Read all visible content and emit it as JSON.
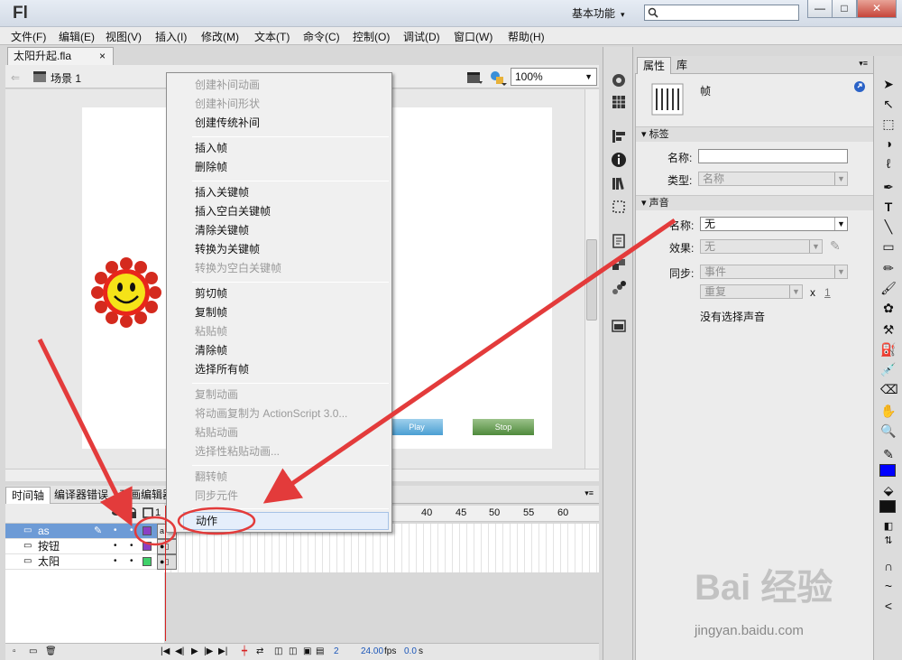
{
  "app": {
    "logo": "Fl",
    "workspace": "基本功能",
    "doc_tab": "太阳升起.fla",
    "zoom": "100%"
  },
  "menu": [
    "文件(F)",
    "编辑(E)",
    "视图(V)",
    "插入(I)",
    "修改(M)",
    "文本(T)",
    "命令(C)",
    "控制(O)",
    "调试(D)",
    "窗口(W)",
    "帮助(H)"
  ],
  "scene": {
    "label": "场景 1"
  },
  "stage": {
    "play_button": "Play",
    "stop_button": "Stop"
  },
  "context_menu": {
    "groups": [
      [
        {
          "label": "创建补间动画",
          "enabled": false
        },
        {
          "label": "创建补间形状",
          "enabled": false
        },
        {
          "label": "创建传统补间",
          "enabled": true
        }
      ],
      [
        {
          "label": "插入帧",
          "enabled": true
        },
        {
          "label": "删除帧",
          "enabled": true
        }
      ],
      [
        {
          "label": "插入关键帧",
          "enabled": true
        },
        {
          "label": "插入空白关键帧",
          "enabled": true
        },
        {
          "label": "清除关键帧",
          "enabled": true
        },
        {
          "label": "转换为关键帧",
          "enabled": true
        },
        {
          "label": "转换为空白关键帧",
          "enabled": false
        }
      ],
      [
        {
          "label": "剪切帧",
          "enabled": true
        },
        {
          "label": "复制帧",
          "enabled": true
        },
        {
          "label": "粘贴帧",
          "enabled": false
        },
        {
          "label": "清除帧",
          "enabled": true
        },
        {
          "label": "选择所有帧",
          "enabled": true
        }
      ],
      [
        {
          "label": "复制动画",
          "enabled": false
        },
        {
          "label": "将动画复制为 ActionScript 3.0...",
          "enabled": false
        },
        {
          "label": "粘贴动画",
          "enabled": false
        },
        {
          "label": "选择性粘贴动画...",
          "enabled": false
        }
      ],
      [
        {
          "label": "翻转帧",
          "enabled": false
        },
        {
          "label": "同步元件",
          "enabled": false
        }
      ],
      [
        {
          "label": "动作",
          "enabled": true,
          "highlighted": true
        }
      ]
    ]
  },
  "timeline": {
    "tabs": [
      "时间轴",
      "编译器错误",
      "动画编辑器"
    ],
    "ruler": [
      "40",
      "45",
      "50",
      "55",
      "60"
    ],
    "ruler_partial": "1",
    "layers": [
      {
        "name": "as",
        "selected": true,
        "color": "#8b3fc4"
      },
      {
        "name": "按钮",
        "selected": false,
        "color": "#8b3fc4"
      },
      {
        "name": "太阳",
        "selected": false,
        "color": "#3fd16a"
      }
    ],
    "frame_label": "a",
    "current_frame": "2",
    "fps": "24.00",
    "fps_unit": "fps",
    "time": "0.0",
    "time_unit": "s"
  },
  "properties": {
    "tabs": [
      "属性",
      "库"
    ],
    "object_type": "帧",
    "sections": {
      "label": "标签",
      "sound": "声音"
    },
    "label_name_label": "名称:",
    "label_name_value": "",
    "label_type_label": "类型:",
    "label_type_value": "名称",
    "sound_name_label": "名称:",
    "sound_name_value": "无",
    "effect_label": "效果:",
    "effect_value": "无",
    "sync_label": "同步:",
    "sync_value": "事件",
    "repeat_value": "重复",
    "repeat_x": "x",
    "repeat_count": "1",
    "no_sound": "没有选择声音"
  },
  "watermark": {
    "text": "Bai 经验",
    "url": "jingyan.baidu.com"
  },
  "colors": {
    "stroke": "#111111",
    "fill": "#0000ff",
    "highlight": "#e5eefb",
    "arrow": "#e33b3b"
  }
}
